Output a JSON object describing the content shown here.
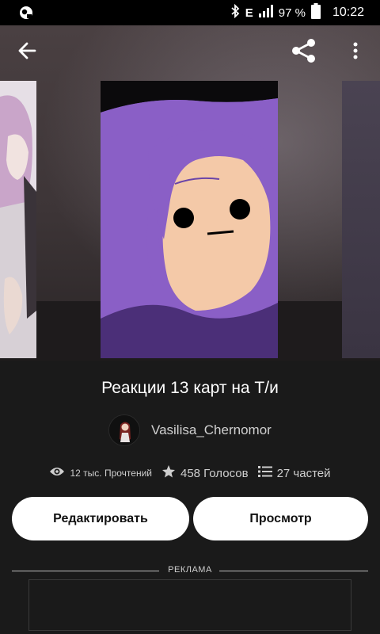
{
  "status_bar": {
    "battery_percent": "97 %",
    "time": "10:22",
    "network_type": "E",
    "icons": [
      "app-notification-icon",
      "bluetooth-icon",
      "signal-icon",
      "battery-icon"
    ]
  },
  "app_bar": {
    "back_icon": "arrow-left-icon",
    "share_icon": "share-icon",
    "more_icon": "more-vertical-icon"
  },
  "story": {
    "title": "Реакции 13 карт на Т/и",
    "author": "Vasilisa_Chernomor",
    "stats": {
      "reads": "12 тыс. Прочтений",
      "votes": "458 Голосов",
      "parts": "27 частей"
    }
  },
  "actions": {
    "edit_label": "Редактировать",
    "view_label": "Просмотр"
  },
  "ad": {
    "label": "РЕКЛАМА"
  },
  "colors": {
    "background": "#1a1a1a",
    "button_bg": "#ffffff",
    "cover_hair": "#8a5fc6",
    "cover_face": "#f4c9a8"
  }
}
